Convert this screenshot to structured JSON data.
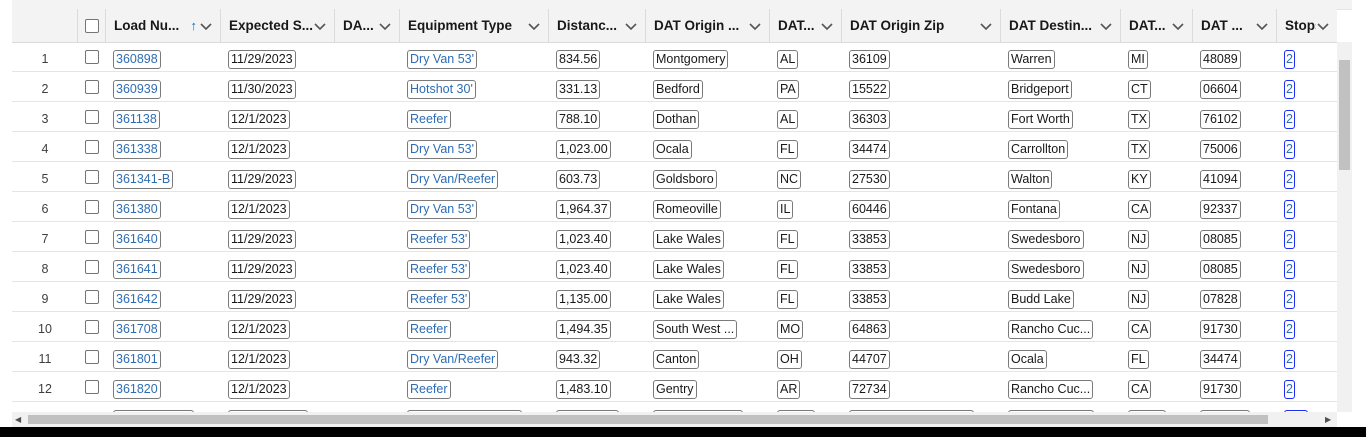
{
  "columns": [
    {
      "key": "load",
      "label": "Load Nu...",
      "sorted": "asc"
    },
    {
      "key": "expected",
      "label": "Expected S..."
    },
    {
      "key": "da",
      "label": "DA..."
    },
    {
      "key": "equipment",
      "label": "Equipment Type"
    },
    {
      "key": "distance",
      "label": "Distanc..."
    },
    {
      "key": "origin_city",
      "label": "DAT Origin ..."
    },
    {
      "key": "origin_state",
      "label": "DAT..."
    },
    {
      "key": "origin_zip",
      "label": "DAT Origin Zip"
    },
    {
      "key": "dest_city",
      "label": "DAT Destin..."
    },
    {
      "key": "dest_state",
      "label": "DAT..."
    },
    {
      "key": "dest_zip",
      "label": "DAT ..."
    },
    {
      "key": "stops",
      "label": "Stops"
    }
  ],
  "rows": [
    {
      "num": "1",
      "load": "360898",
      "expected": "11/29/2023",
      "equipment": "Dry Van 53'",
      "distance": "834.56",
      "origin_city": "Montgomery",
      "origin_state": "AL",
      "origin_zip": "36109",
      "dest_city": "Warren",
      "dest_state": "MI",
      "dest_zip": "48089",
      "stops": "2"
    },
    {
      "num": "2",
      "load": "360939",
      "expected": "11/30/2023",
      "equipment": "Hotshot 30'",
      "distance": "331.13",
      "origin_city": "Bedford",
      "origin_state": "PA",
      "origin_zip": "15522",
      "dest_city": "Bridgeport",
      "dest_state": "CT",
      "dest_zip": "06604",
      "stops": "2"
    },
    {
      "num": "3",
      "load": "361138",
      "expected": "12/1/2023",
      "equipment": "Reefer",
      "distance": "788.10",
      "origin_city": "Dothan",
      "origin_state": "AL",
      "origin_zip": "36303",
      "dest_city": "Fort Worth",
      "dest_state": "TX",
      "dest_zip": "76102",
      "stops": "2"
    },
    {
      "num": "4",
      "load": "361338",
      "expected": "12/1/2023",
      "equipment": "Dry Van 53'",
      "distance": "1,023.00",
      "origin_city": "Ocala",
      "origin_state": "FL",
      "origin_zip": "34474",
      "dest_city": "Carrollton",
      "dest_state": "TX",
      "dest_zip": "75006",
      "stops": "2"
    },
    {
      "num": "5",
      "load": "361341-B",
      "expected": "11/29/2023",
      "equipment": "Dry Van/Reefer",
      "distance": "603.73",
      "origin_city": "Goldsboro",
      "origin_state": "NC",
      "origin_zip": "27530",
      "dest_city": "Walton",
      "dest_state": "KY",
      "dest_zip": "41094",
      "stops": "2"
    },
    {
      "num": "6",
      "load": "361380",
      "expected": "12/1/2023",
      "equipment": "Dry Van 53'",
      "distance": "1,964.37",
      "origin_city": "Romeoville",
      "origin_state": "IL",
      "origin_zip": "60446",
      "dest_city": "Fontana",
      "dest_state": "CA",
      "dest_zip": "92337",
      "stops": "2"
    },
    {
      "num": "7",
      "load": "361640",
      "expected": "11/29/2023",
      "equipment": "Reefer 53'",
      "distance": "1,023.40",
      "origin_city": "Lake Wales",
      "origin_state": "FL",
      "origin_zip": "33853",
      "dest_city": "Swedesboro",
      "dest_state": "NJ",
      "dest_zip": "08085",
      "stops": "2"
    },
    {
      "num": "8",
      "load": "361641",
      "expected": "11/29/2023",
      "equipment": "Reefer 53'",
      "distance": "1,023.40",
      "origin_city": "Lake Wales",
      "origin_state": "FL",
      "origin_zip": "33853",
      "dest_city": "Swedesboro",
      "dest_state": "NJ",
      "dest_zip": "08085",
      "stops": "2"
    },
    {
      "num": "9",
      "load": "361642",
      "expected": "11/29/2023",
      "equipment": "Reefer 53'",
      "distance": "1,135.00",
      "origin_city": "Lake Wales",
      "origin_state": "FL",
      "origin_zip": "33853",
      "dest_city": "Budd Lake",
      "dest_state": "NJ",
      "dest_zip": "07828",
      "stops": "2"
    },
    {
      "num": "10",
      "load": "361708",
      "expected": "12/1/2023",
      "equipment": "Reefer",
      "distance": "1,494.35",
      "origin_city": "South West ...",
      "origin_state": "MO",
      "origin_zip": "64863",
      "dest_city": "Rancho Cuc...",
      "dest_state": "CA",
      "dest_zip": "91730",
      "stops": "2"
    },
    {
      "num": "11",
      "load": "361801",
      "expected": "12/1/2023",
      "equipment": "Dry Van/Reefer",
      "distance": "943.32",
      "origin_city": "Canton",
      "origin_state": "OH",
      "origin_zip": "44707",
      "dest_city": "Ocala",
      "dest_state": "FL",
      "dest_zip": "34474",
      "stops": "2"
    },
    {
      "num": "12",
      "load": "361820",
      "expected": "12/1/2023",
      "equipment": "Reefer",
      "distance": "1,483.10",
      "origin_city": "Gentry",
      "origin_state": "AR",
      "origin_zip": "72734",
      "dest_city": "Rancho Cuc...",
      "dest_state": "CA",
      "dest_zip": "91730",
      "stops": "2"
    }
  ]
}
